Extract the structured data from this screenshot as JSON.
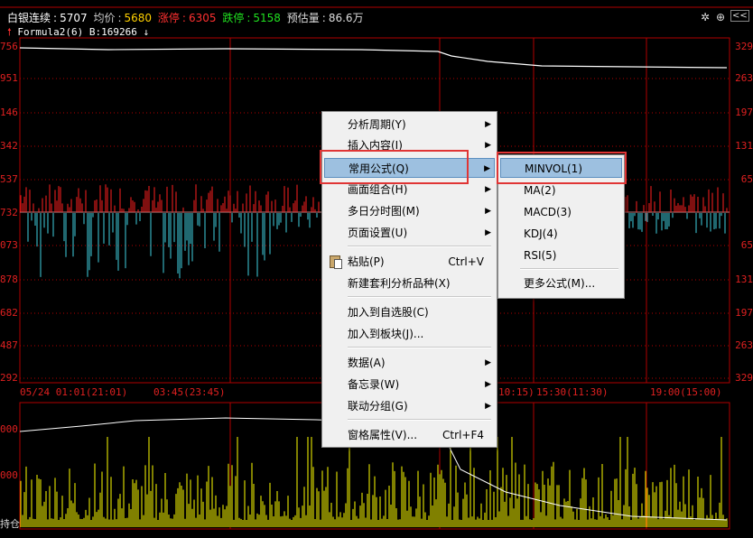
{
  "header": {
    "name": "白银连续",
    "price": "5707",
    "avg_label": "均价",
    "avg": "5680",
    "limit_up_label": "涨停",
    "limit_up": "6305",
    "limit_down_label": "跌停",
    "limit_down": "5158",
    "est_vol_label": "预估量",
    "est_vol": "86.6万"
  },
  "formula": {
    "text": "Formula2(6)",
    "b_label": "B:",
    "b_value": "169266"
  },
  "toolbar": {
    "settings_glyph": "✲",
    "up_glyph": "⊕",
    "collapse_glyph": "<<"
  },
  "y_axis_left": [
    "756",
    "951",
    "146",
    "342",
    "537",
    "732",
    "073",
    "878",
    "682",
    "487",
    "292"
  ],
  "y_axis_right": [
    "329",
    "263",
    "197",
    "131",
    "65",
    "",
    "65",
    "131",
    "197",
    "263",
    "329"
  ],
  "vol_axis_left": [
    "000",
    "000"
  ],
  "vol_label": "持仓",
  "x_axis_labels": [
    "05/24 01:01(21:01)",
    "03:45(23:45)",
    "10:15)",
    "15:30(11:30)",
    "19:00(15:00)"
  ],
  "colors": {
    "up_bar": "#ff2020",
    "down_bar": "#40d0e0",
    "vol_bar": "#ffff00",
    "grid": "#b00000",
    "price_line": "#ffffff",
    "highlight": "#9dc0e0",
    "callout": "#e03535"
  },
  "context_menu": {
    "items": [
      {
        "label": "分析周期(Y)",
        "submenu": true
      },
      {
        "label": "插入内容(I)",
        "submenu": true
      },
      {
        "label": "常用公式(Q)",
        "submenu": true,
        "highlighted": true
      },
      {
        "label": "画面组合(H)",
        "submenu": true
      },
      {
        "label": "多日分时图(M)",
        "submenu": true
      },
      {
        "label": "页面设置(U)",
        "submenu": true
      },
      {
        "label": "粘贴(P)",
        "shortcut": "Ctrl+V",
        "icon": "paste-icon"
      },
      {
        "label": "新建套利分析品种(X)"
      },
      {
        "label": "加入到自选股(C)"
      },
      {
        "label": "加入到板块(J)..."
      },
      {
        "label": "数据(A)",
        "submenu": true
      },
      {
        "label": "备忘录(W)",
        "submenu": true
      },
      {
        "label": "联动分组(G)",
        "submenu": true
      },
      {
        "label": "窗格属性(V)...",
        "shortcut": "Ctrl+F4"
      }
    ]
  },
  "submenu": {
    "items": [
      {
        "label": "MINVOL(1)",
        "highlighted": true
      },
      {
        "label": "MA(2)"
      },
      {
        "label": "MACD(3)"
      },
      {
        "label": "KDJ(4)"
      },
      {
        "label": "RSI(5)"
      },
      {
        "label": "更多公式(M)..."
      }
    ]
  }
}
